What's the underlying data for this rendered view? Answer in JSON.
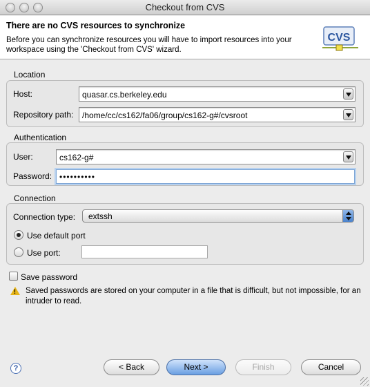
{
  "window": {
    "title": "Checkout from CVS"
  },
  "banner": {
    "title": "There are no CVS resources to synchronize",
    "description": "Before you can synchronize resources you will have to import resources into your workspace using the 'Checkout from CVS' wizard.",
    "logo_text": "CVS"
  },
  "location": {
    "group_label": "Location",
    "host_label": "Host:",
    "host_value": "quasar.cs.berkeley.edu",
    "repo_label": "Repository path:",
    "repo_value": "/home/cc/cs162/fa06/group/cs162-g#/cvsroot"
  },
  "authentication": {
    "group_label": "Authentication",
    "user_label": "User:",
    "user_value": "cs162-g#",
    "password_label": "Password:",
    "password_value": "••••••••••"
  },
  "connection": {
    "group_label": "Connection",
    "type_label": "Connection type:",
    "type_value": "extssh",
    "default_port_label": "Use default port",
    "use_port_label": "Use port:",
    "port_value": ""
  },
  "save_password": {
    "label": "Save password",
    "checked": false,
    "warning": "Saved passwords are stored on your computer in a file that is difficult, but not impossible, for an intruder to read."
  },
  "buttons": {
    "back": "< Back",
    "next": "Next >",
    "finish": "Finish",
    "cancel": "Cancel",
    "help": "?"
  },
  "colors": {
    "default_button": "#6a9fe2",
    "warning": "#e5b317"
  }
}
